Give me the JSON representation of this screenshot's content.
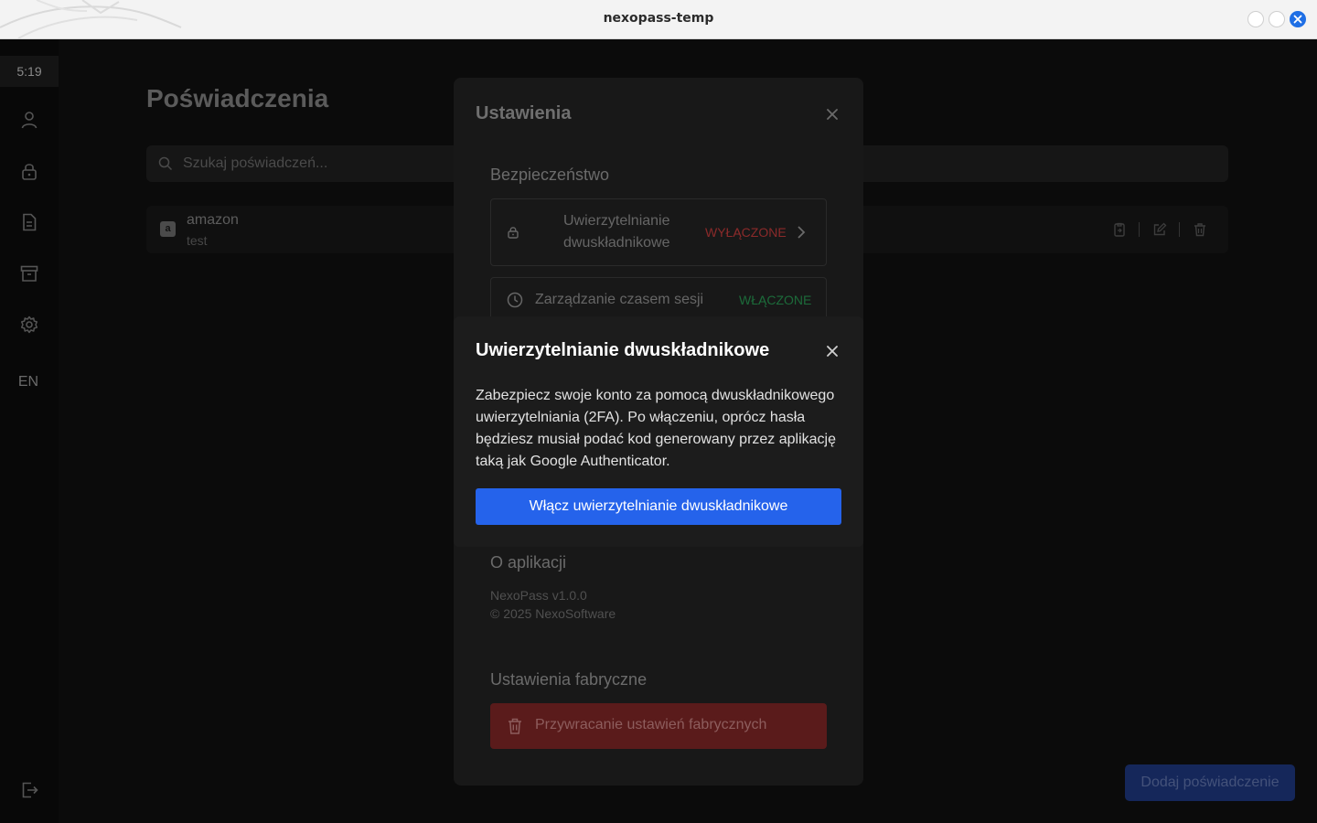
{
  "window": {
    "title": "nexopass-temp"
  },
  "sidebar": {
    "time": "5:19",
    "items": [
      {
        "icon": "user-icon"
      },
      {
        "icon": "lock-icon"
      },
      {
        "icon": "document-icon"
      },
      {
        "icon": "archive-icon"
      },
      {
        "icon": "gear-icon"
      }
    ],
    "language": "EN",
    "logout_icon": "logout-icon"
  },
  "main": {
    "title": "Poświadczenia",
    "search_placeholder": "Szukaj poświadczeń...",
    "credentials": [
      {
        "name": "amazon",
        "username": "test",
        "logo": "a"
      }
    ],
    "add_button": "Dodaj poświadczenie"
  },
  "settings": {
    "title": "Ustawienia",
    "security_heading": "Bezpieczeństwo",
    "two_factor": {
      "label_line1": "Uwierzytelnianie",
      "label_line2": "dwuskładnikowe",
      "status": "WYŁĄCZONE",
      "status_color": "#8b2a2a"
    },
    "session": {
      "label": "Zarządzanie czasem sesji",
      "status": "WŁĄCZONE",
      "status_color": "#1c6b3a"
    },
    "about_heading": "O aplikacji",
    "version": "NexoPass v1.0.0",
    "copyright": "© 2025 NexoSoftware",
    "factory_heading": "Ustawienia fabryczne",
    "reset_button": "Przywracanie ustawień fabrycznych"
  },
  "dialog": {
    "title": "Uwierzytelnianie dwuskładnikowe",
    "description": "Zabezpiecz swoje konto za pomocą dwuskładnikowego uwierzytelniania (2FA). Po włączeniu, oprócz hasła będziesz musiał podać kod generowany przez aplikację taką jak Google Authenticator.",
    "enable_button": "Włącz uwierzytelnianie dwuskładnikowe",
    "accent": "#2563eb"
  }
}
